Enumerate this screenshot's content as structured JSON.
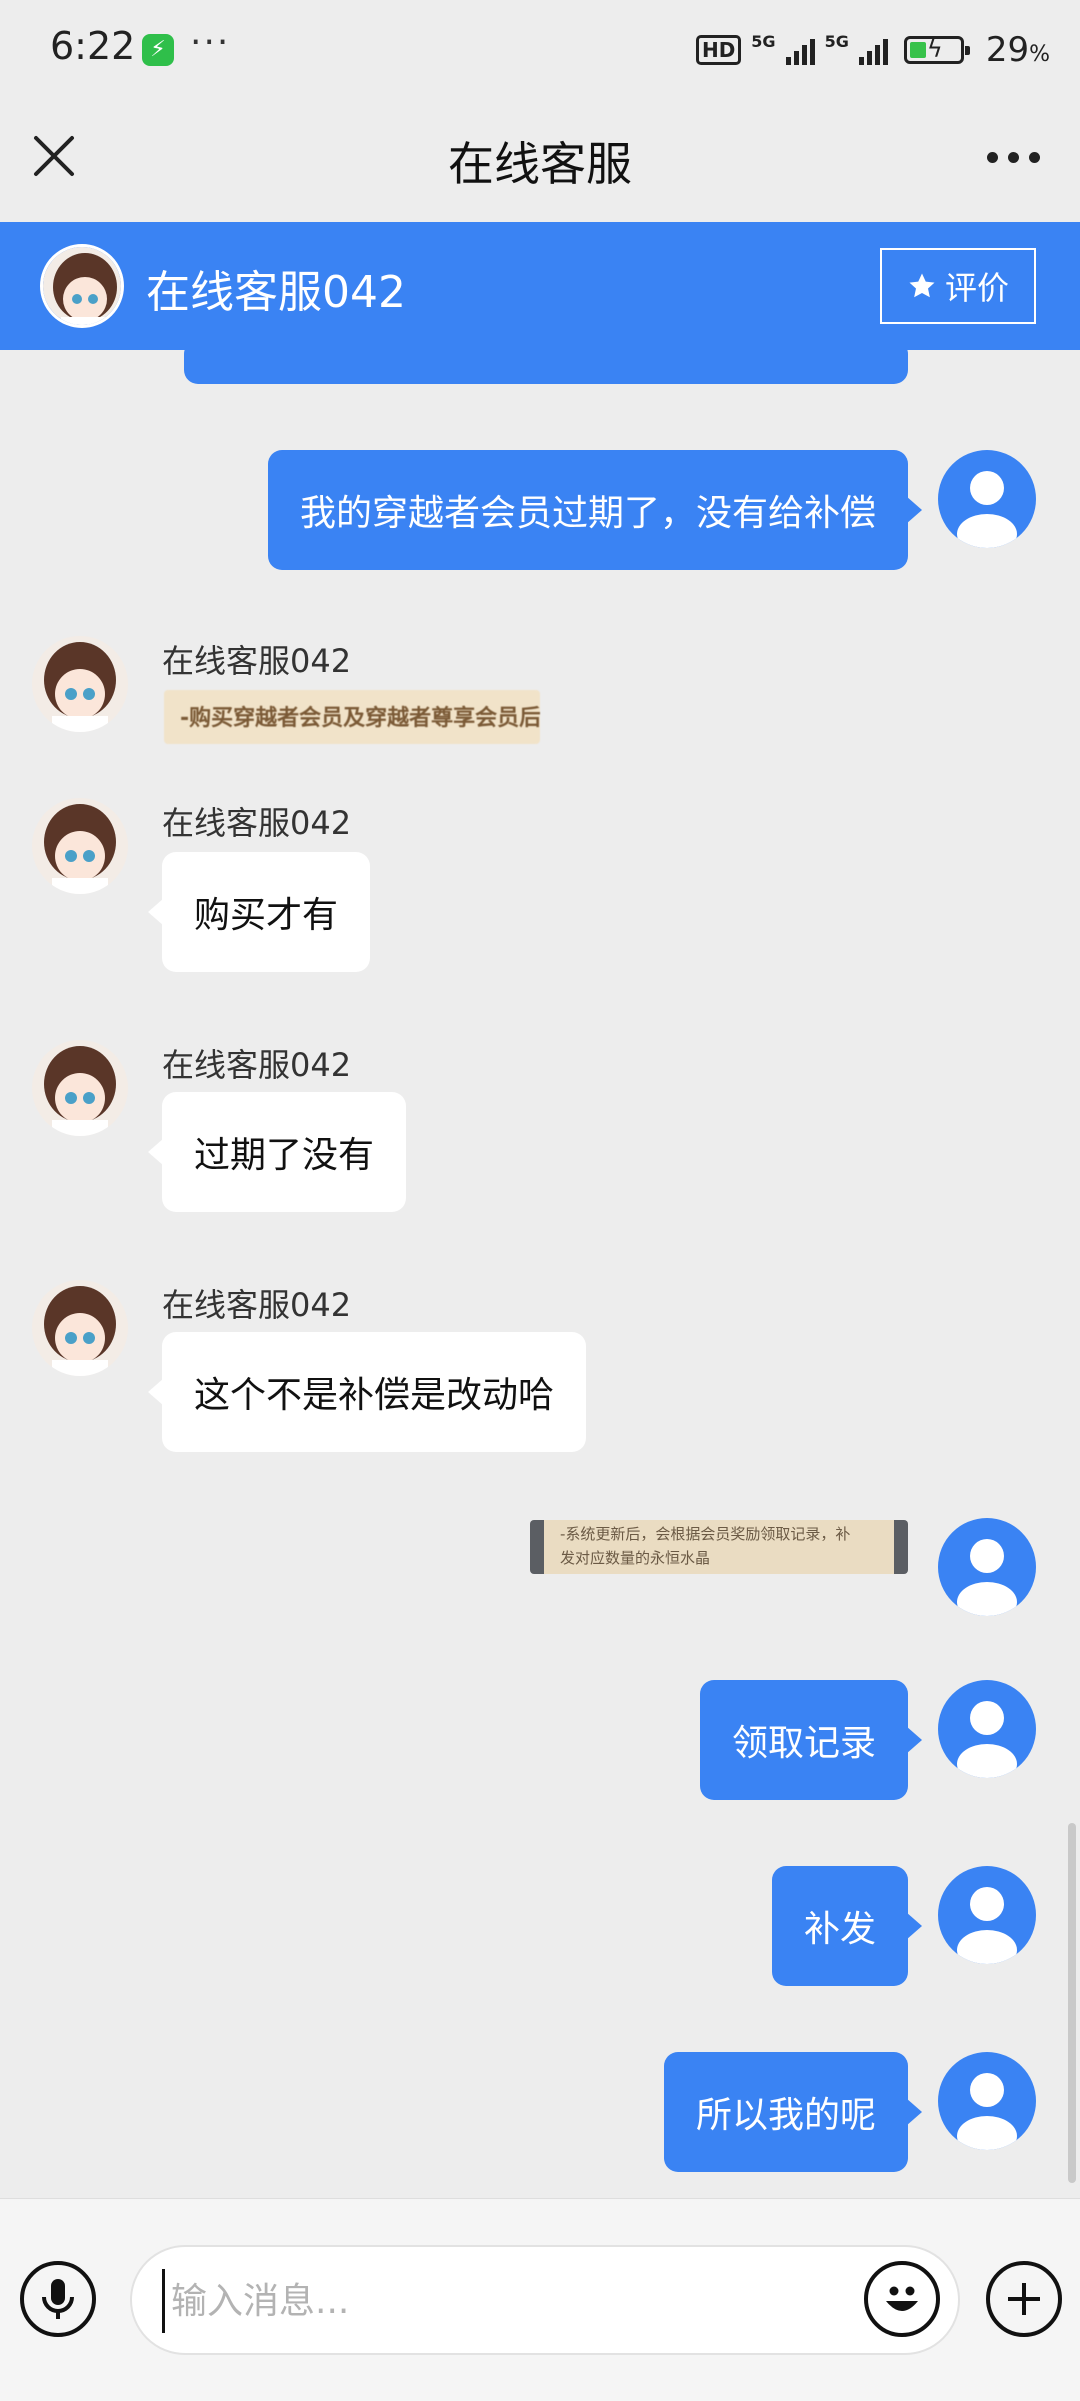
{
  "status_bar": {
    "time": "6:22",
    "notification": "···",
    "hd_label": "HD",
    "net1": "5G",
    "net2": "5G",
    "battery_pct": "29",
    "battery_unit": "%"
  },
  "nav": {
    "title": "在线客服"
  },
  "agent_header": {
    "name": "在线客服042",
    "rate_label": "评价"
  },
  "messages": [
    {
      "from": "user",
      "type": "text",
      "text": "我的穿越者会员过期了，没有给补偿"
    },
    {
      "from": "agent",
      "sender": "在线客服042",
      "type": "image",
      "image_text": "-购买穿越者会员及穿越者尊享会员后,"
    },
    {
      "from": "agent",
      "sender": "在线客服042",
      "type": "text",
      "text": "购买才有"
    },
    {
      "from": "agent",
      "sender": "在线客服042",
      "type": "text",
      "text": "过期了没有"
    },
    {
      "from": "agent",
      "sender": "在线客服042",
      "type": "text",
      "text": "这个不是补偿是改动哈"
    },
    {
      "from": "user",
      "type": "image",
      "image_text_line1": "-系统更新后，会根据会员奖励领取记录，补",
      "image_text_line2": "发对应数量的永恒水晶"
    },
    {
      "from": "user",
      "type": "text",
      "text": "领取记录"
    },
    {
      "from": "user",
      "type": "text",
      "text": "补发"
    },
    {
      "from": "user",
      "type": "text",
      "text": "所以我的呢"
    }
  ],
  "input_bar": {
    "placeholder": "输入消息..."
  },
  "colors": {
    "brand_blue": "#3a83f3",
    "background": "#ededed"
  }
}
